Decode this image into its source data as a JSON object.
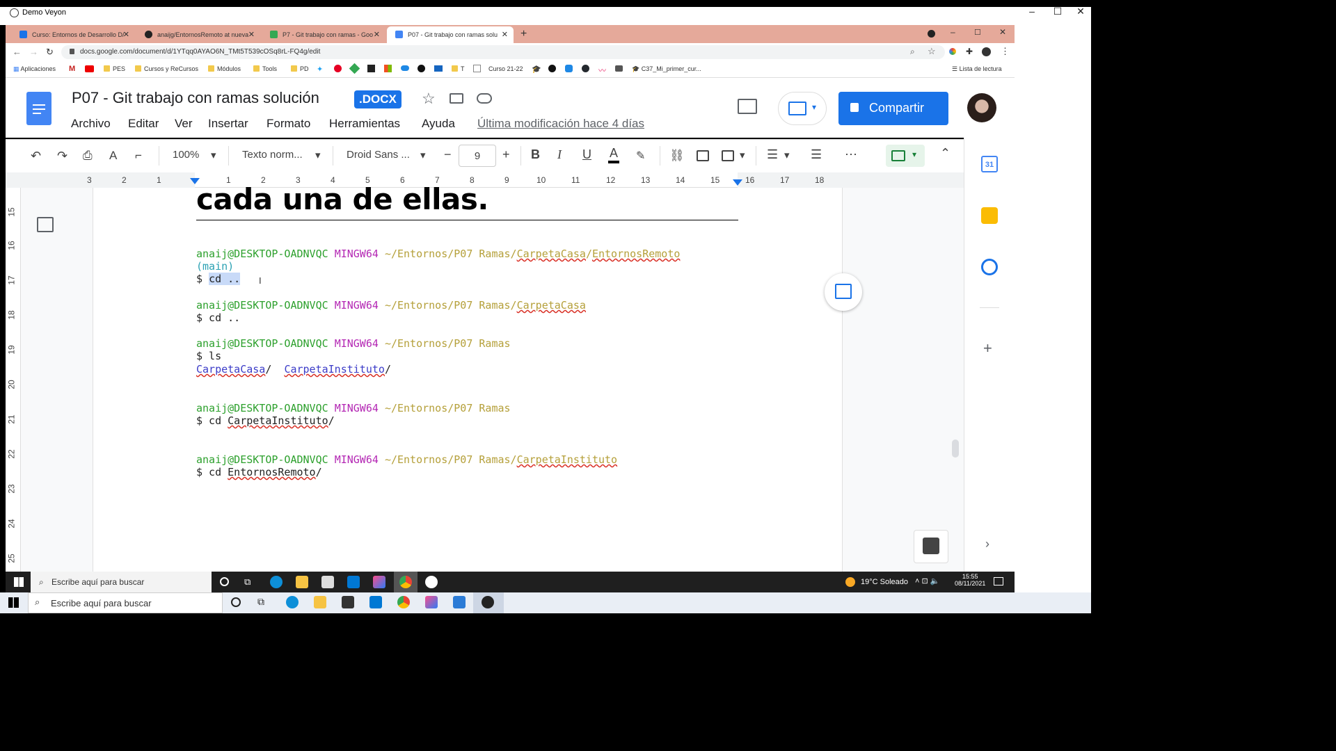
{
  "veyon": {
    "title": "Demo Veyon",
    "min": "–",
    "max": "☐",
    "close": "✕"
  },
  "tabs": [
    {
      "label": "Curso: Entornos de Desarrollo D/",
      "color": "#1a73e8"
    },
    {
      "label": "anaijg/EntornosRemoto at nueva",
      "color": "#222"
    },
    {
      "label": "P7 - Git trabajo con ramas - Goo",
      "color": "#34a853"
    },
    {
      "label": "P07 - Git trabajo con ramas solu",
      "color": "#4285f4"
    }
  ],
  "new_tab": "+",
  "tab_close": "✕",
  "address": {
    "url": "docs.google.com/document/d/1YTqq0AYAO6N_TMt5T539cOSq8rL-FQ4g/edit"
  },
  "bookmarks": {
    "apps": "Aplicaciones",
    "items": [
      "PES",
      "Cursos y ReCursos",
      "Módulos",
      "Tools",
      "PD",
      "T",
      "Curso 21-22",
      "C37_Mi_primer_cur..."
    ],
    "reading_list": "Lista de lectura"
  },
  "docs": {
    "title": "P07 - Git trabajo con ramas solución",
    "badge": ".DOCX",
    "menu": [
      "Archivo",
      "Editar",
      "Ver",
      "Insertar",
      "Formato",
      "Herramientas",
      "Ayuda"
    ],
    "last_modified": "Última modificación hace 4 días",
    "share": "Compartir"
  },
  "toolbar": {
    "zoom": "100%",
    "style": "Texto norm...",
    "font": "Droid Sans ...",
    "font_size": "9",
    "minus": "−",
    "plus": "+",
    "bold": "B",
    "italic": "I",
    "underline": "U",
    "textcolor": "A",
    "more": "⋯",
    "collapse": "⌃"
  },
  "ruler": {
    "numbers": [
      "3",
      "2",
      "1",
      "1",
      "2",
      "3",
      "4",
      "5",
      "6",
      "7",
      "8",
      "9",
      "10",
      "11",
      "12",
      "13",
      "14",
      "15",
      "16",
      "17",
      "18"
    ]
  },
  "vruler": {
    "numbers": [
      "15",
      "16",
      "17",
      "18",
      "19",
      "20",
      "21",
      "22",
      "23",
      "24",
      "25"
    ]
  },
  "document": {
    "heading": "cada una de ellas.",
    "user": "anaij@DESKTOP-OADNVQC",
    "mingw": "MINGW64",
    "path1": "~/Entornos/P07 Ramas/",
    "path1a": "CarpetaCasa",
    "slash": "/",
    "path1b": "EntornosRemoto",
    "branch": "(main)",
    "cmd1": "cd ..",
    "prompt": "$ ",
    "path2": "~/Entornos/P07 Ramas/",
    "path2a": "CarpetaCasa",
    "cmd2": "$ cd ..",
    "path3": "~/Entornos/P07 Ramas",
    "cmd3": "$ ls",
    "ls1": "CarpetaCasa",
    "ls2": "CarpetaInstituto",
    "path4": "~/Entornos/P07 Ramas",
    "cmd4a": "$ cd ",
    "cmd4b": "CarpetaInstituto",
    "path5": "~/Entornos/P07 Ramas/",
    "path5a": "CarpetaInstituto",
    "cmd5a": "$ cd ",
    "cmd5b": "EntornosRemoto"
  },
  "taskbar": {
    "search": "Escribe aquí para buscar",
    "weather": "19°C  Soleado",
    "time": "15:55",
    "date": "08/11/2021",
    "search2": "Escribe aquí para buscar"
  },
  "colors": {
    "accent": "#1a73e8",
    "tabstrip": "#e5a99a"
  }
}
